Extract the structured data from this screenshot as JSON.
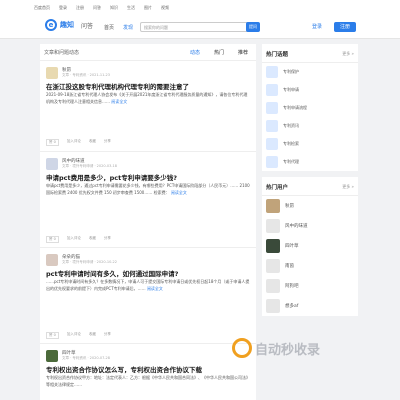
{
  "topbar": {
    "links": [
      "百度首页",
      "登录",
      "注册",
      "问答",
      "知识",
      "生活",
      "图片",
      "视频"
    ]
  },
  "header": {
    "logo_text": "趣知",
    "logo_sub": "问答",
    "nav": [
      {
        "label": "首页",
        "active": false
      },
      {
        "label": "发现",
        "active": true
      }
    ],
    "search_placeholder": "搜索你的问题",
    "search_button": "提问",
    "login": "登录",
    "register": "注册"
  },
  "main": {
    "title": "文章和问题动态",
    "tabs": [
      {
        "label": "动态",
        "on": true
      },
      {
        "label": "热门",
        "on": false
      },
      {
        "label": "推荐",
        "on": false
      }
    ],
    "posts": [
      {
        "author": "秋昂",
        "meta": "文章 · 专利资讯 · 2021-11-23",
        "title": "在浙江投这股专利代理机构代理专利的需要注意了",
        "body": "2021-09-18浙江省专利代理人协会发布《关于开展2021年度浙江省专利代理服务质量的通知》，请各位专利代理机构及专利代理人注意相关信息……",
        "more": "阅读全文",
        "actions": [
          "赞 0",
          "加入评论",
          "收藏",
          "分享"
        ]
      },
      {
        "author": "风中的味道",
        "meta": "文章 · 境外专利申请 · 2020-03-18",
        "title": "申请pct费用是多少，pct专利申请要多少钱?",
        "body": "申请pct费用是多少，通过pct专利申请需要花多少钱，有哪些费用？PCT申请国际阶段部分（人民币元）…… 2100 国际检索费 2400 优先权文件费 150 初步审查费 1500…… 检索费：",
        "more": "阅读全文",
        "actions": [
          "赞 0",
          "加入评论",
          "收藏",
          "分享"
        ]
      },
      {
        "author": "朵朵的猫",
        "meta": "文章 · 境外专利申请 · 2020-10-22",
        "title": "pct专利申请时间有多久，如何通过国际申请?",
        "body": "……pct专利申请时间有多久？在多数情况下，申请人可于提交国际专利申请日或优先权日起18个月（或于申请人提出的优先权要求的前提下）内完成PCT专利申请后，……",
        "more": "阅读全文",
        "actions": [
          "赞 0",
          "加入评论",
          "收藏",
          "分享"
        ]
      },
      {
        "author": "四叶草",
        "meta": "文章 · 专利资讯 · 2020-07-28",
        "title": "专利权出资合作协议怎么写，专利权出资合作协议下载",
        "body": "专利权出资合作协议甲方：地址：法定代表人：乙方：根据《中华人民共和国合同法》、《中华人民共和国公司法》等相关法律规定……",
        "more": "",
        "actions": []
      }
    ]
  },
  "side": {
    "hot_topics_title": "热门话题",
    "hot_topics_more": "更多 »",
    "hot_topics": [
      "专利保护",
      "专利申请",
      "专利申请流程",
      "专利资讯",
      "专利检索",
      "专利代理"
    ],
    "hot_users_title": "热门用户",
    "hot_users_more": "更多 »",
    "hot_users": [
      "秋昂",
      "风中的味道",
      "四叶草",
      "南茵",
      "阿狗吧",
      "想多af"
    ]
  },
  "watermark": {
    "text": "自动秒收录"
  },
  "colors": {
    "accent": "#2b7de9",
    "background": "#f1f2f4"
  }
}
